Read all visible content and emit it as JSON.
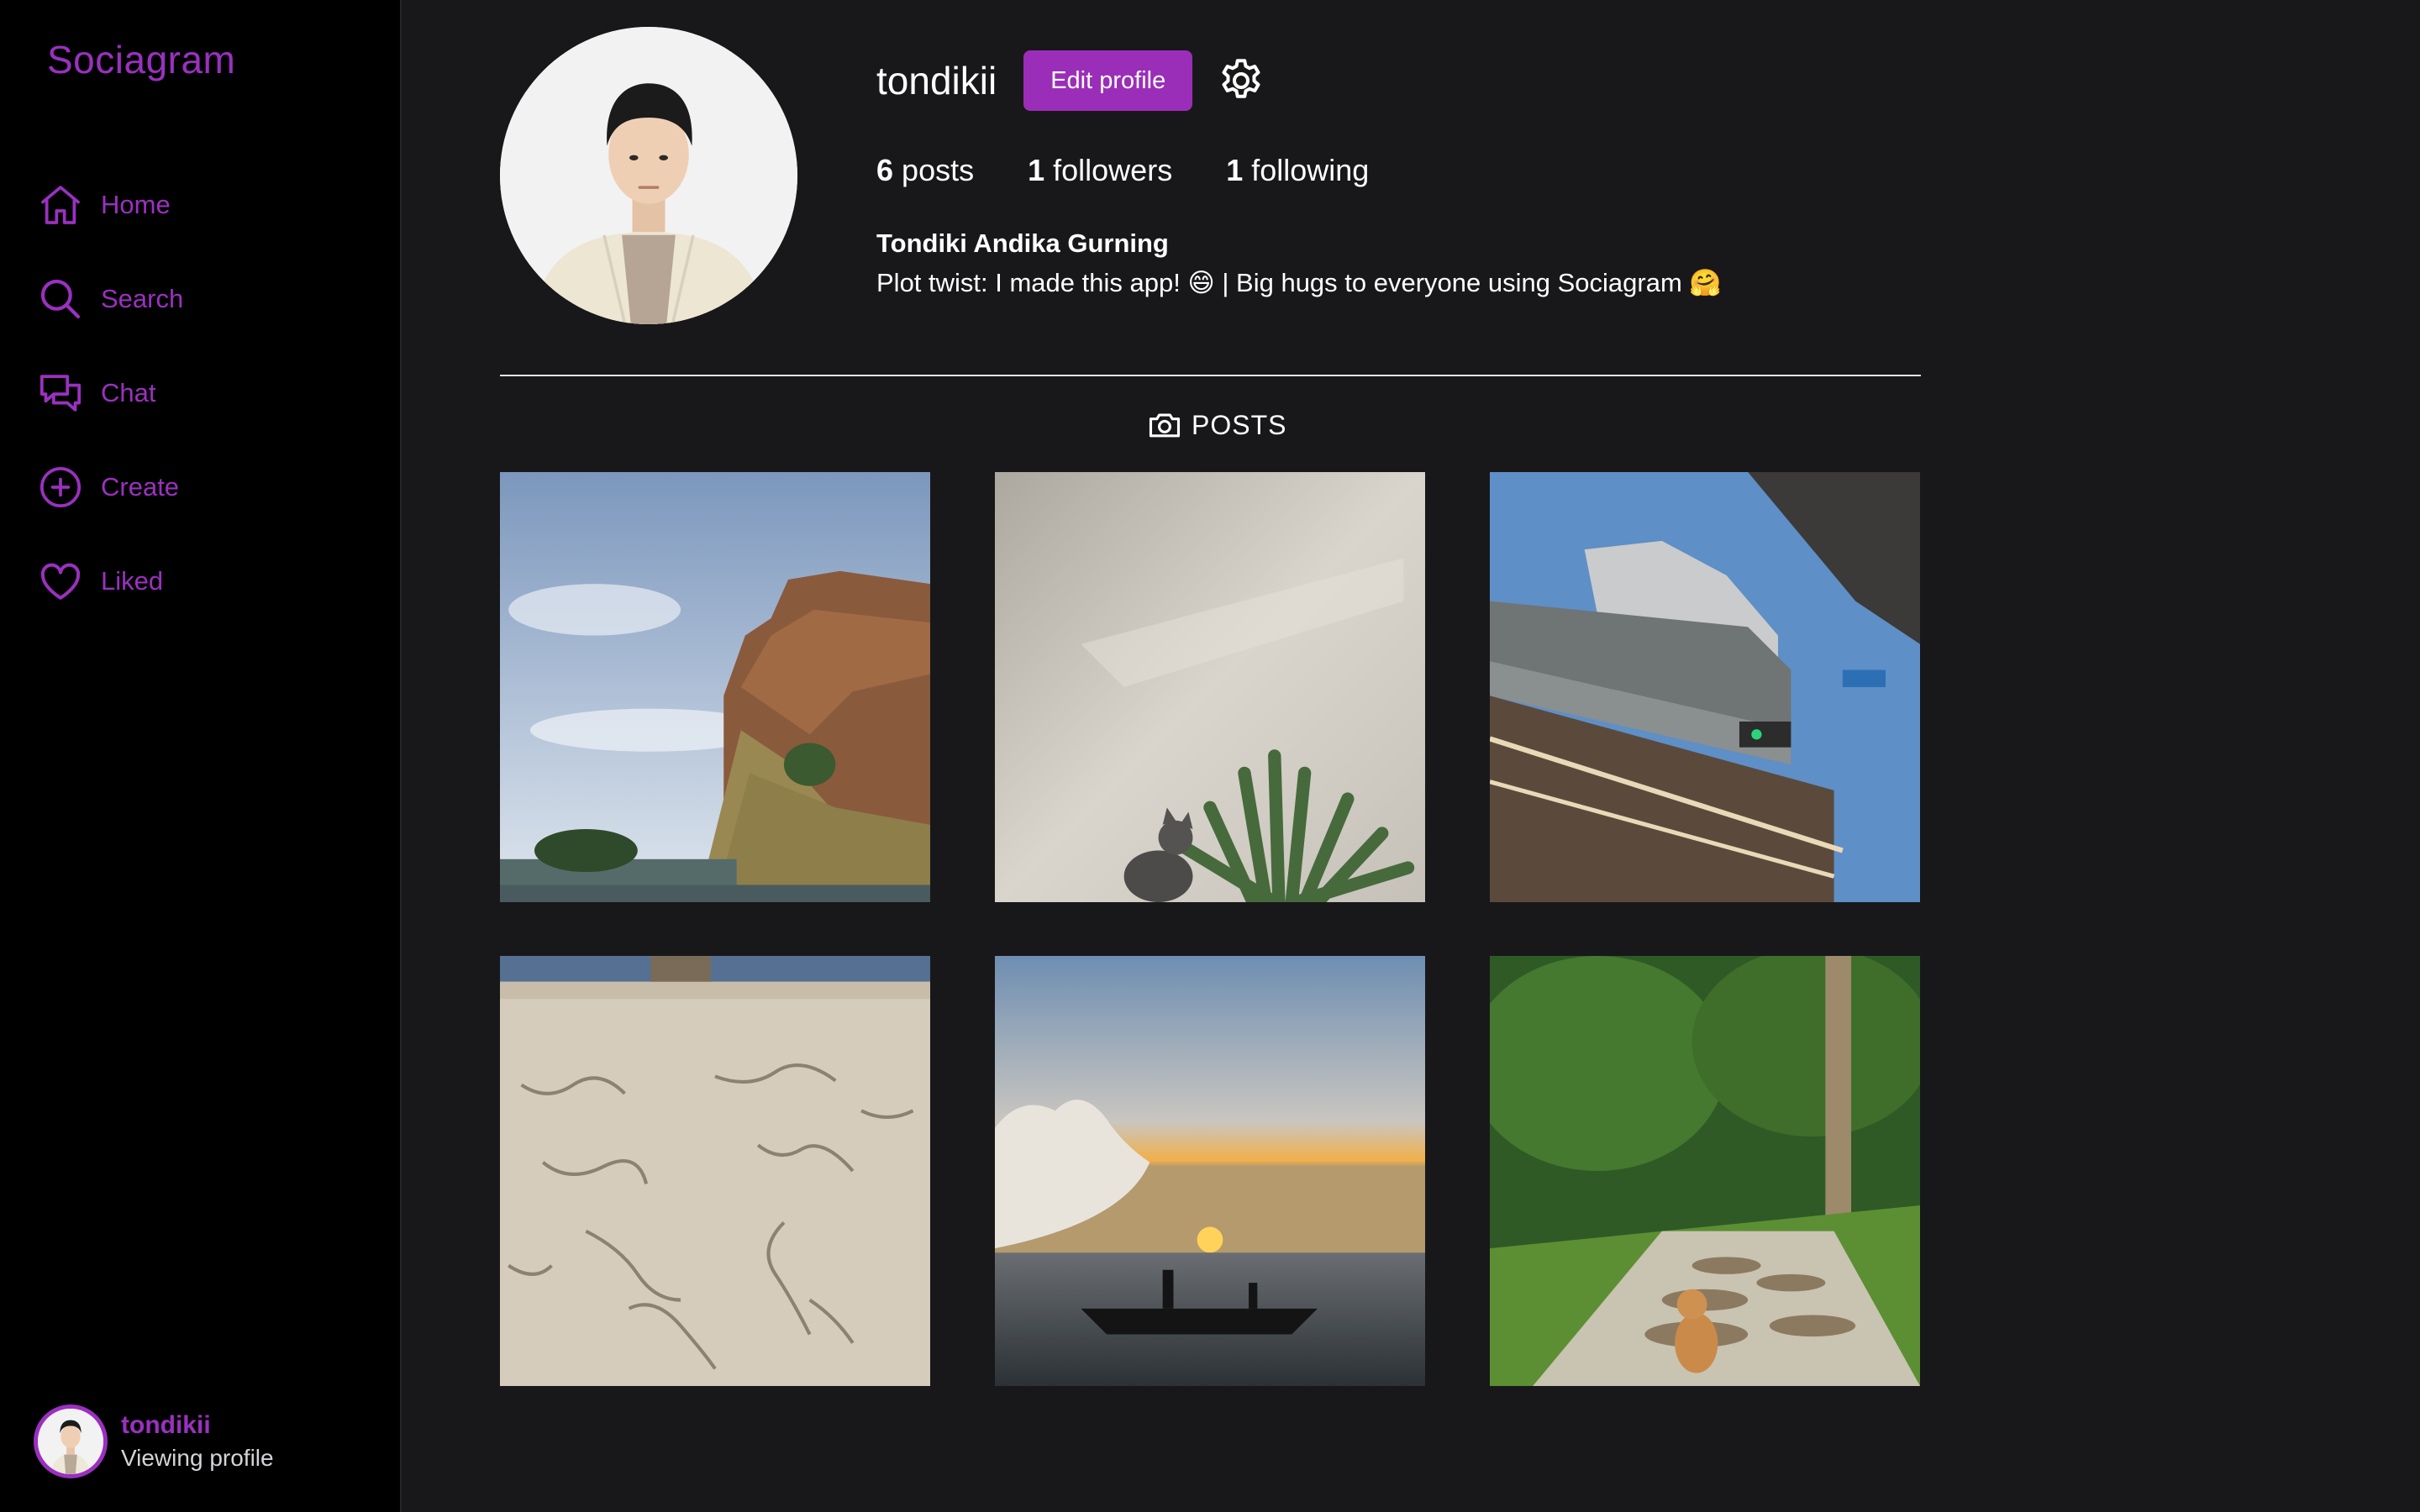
{
  "app": {
    "brand": "Sociagram"
  },
  "sidebar": {
    "items": [
      {
        "label": "Home",
        "icon": "home-icon"
      },
      {
        "label": "Search",
        "icon": "search-icon"
      },
      {
        "label": "Chat",
        "icon": "chat-icon"
      },
      {
        "label": "Create",
        "icon": "plus-circle-icon"
      },
      {
        "label": "Liked",
        "icon": "heart-icon"
      }
    ],
    "user": {
      "name": "tondikii",
      "status": "Viewing profile"
    }
  },
  "profile": {
    "username": "tondikii",
    "edit_label": "Edit profile",
    "stats": {
      "posts_count": "6",
      "posts_label": "posts",
      "followers_count": "1",
      "followers_label": "followers",
      "following_count": "1",
      "following_label": "following"
    },
    "full_name": "Tondiki Andika Gurning",
    "bio": "Plot twist: I made this app! 😄 | Big hugs to everyone using Sociagram 🤗"
  },
  "tabs": {
    "posts_label": "POSTS"
  },
  "posts": [
    {
      "subject": "cliff-coast-photo"
    },
    {
      "subject": "cat-and-plant-photo"
    },
    {
      "subject": "overpass-building-photo"
    },
    {
      "subject": "sand-beach-photo"
    },
    {
      "subject": "sunset-boat-photo"
    },
    {
      "subject": "cat-garden-path-photo"
    }
  ],
  "colors": {
    "accent": "#9b30c0",
    "button": "#9b2eb8",
    "background": "#18181b",
    "sidebar": "#000000"
  }
}
